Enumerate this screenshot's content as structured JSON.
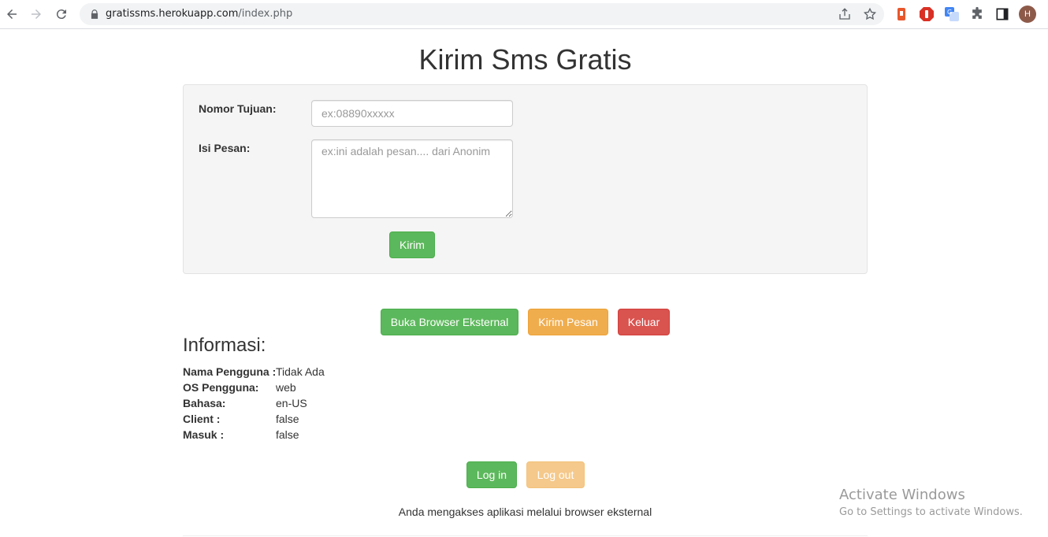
{
  "browser": {
    "url_host": "gratissms.herokuapp.com",
    "url_path": "/index.php",
    "profile_initial": "H"
  },
  "page": {
    "title": "Kirim Sms Gratis"
  },
  "form": {
    "nomor_label": "Nomor Tujuan:",
    "nomor_placeholder": "ex:08890xxxxx",
    "pesan_label": "Isi Pesan:",
    "pesan_placeholder": "ex:ini adalah pesan.... dari Anonim",
    "submit_label": "Kirim"
  },
  "actions": {
    "browser_label": "Buka Browser Eksternal",
    "kirim_pesan_label": "Kirim Pesan",
    "keluar_label": "Keluar"
  },
  "info": {
    "title": "Informasi:",
    "rows": [
      {
        "key": "Nama Pengguna :",
        "value": "Tidak Ada"
      },
      {
        "key": "OS Pengguna:",
        "value": "web"
      },
      {
        "key": "Bahasa:",
        "value": "en-US"
      },
      {
        "key": "Client :",
        "value": "false"
      },
      {
        "key": "Masuk :",
        "value": "false"
      }
    ]
  },
  "auth": {
    "login_label": "Log in",
    "logout_label": "Log out"
  },
  "footer_note": "Anda mengakses aplikasi melalui browser eksternal",
  "watermark": {
    "title": "Activate Windows",
    "subtitle": "Go to Settings to activate Windows."
  },
  "colors": {
    "success": "#5cb85c",
    "warning": "#f0ad4e",
    "danger": "#d9534f"
  }
}
